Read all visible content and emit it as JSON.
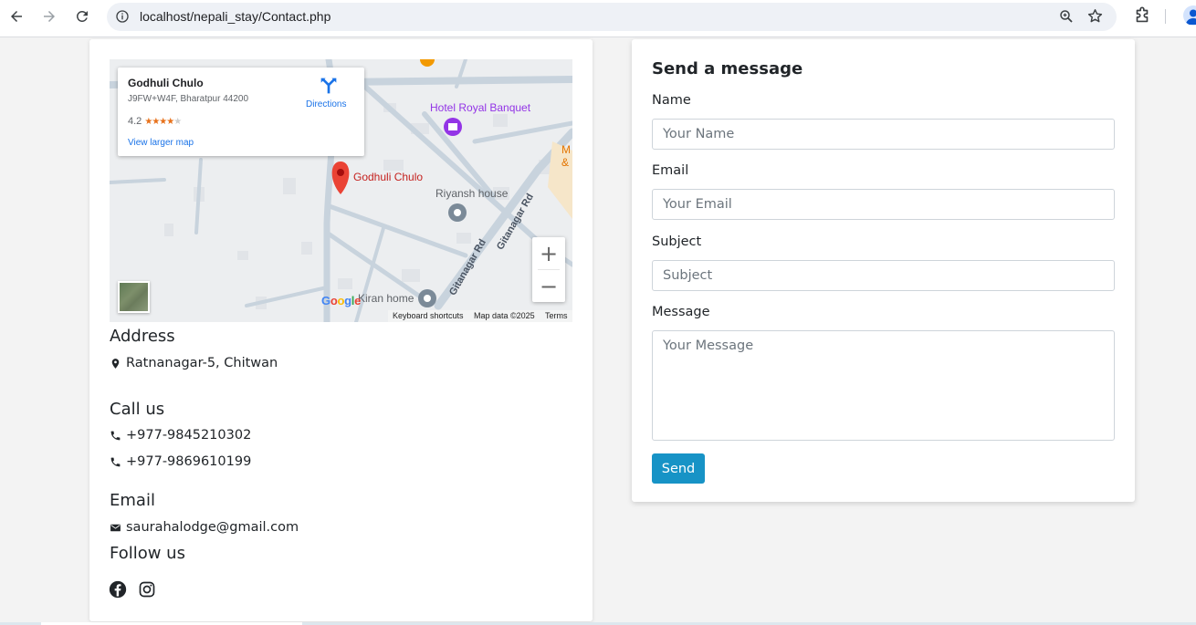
{
  "browser": {
    "url": "localhost/nepali_stay/Contact.php",
    "icons": [
      "back-arrow-icon",
      "forward-arrow-icon",
      "reload-icon",
      "site-info-icon",
      "zoom-icon",
      "bookmark-star-icon",
      "extensions-icon",
      "profile-icon"
    ]
  },
  "map": {
    "place_name": "Godhuli Chulo",
    "place_address": "J9FW+W4F, Bharatpur 44200",
    "rating": "4.2",
    "rating_stars": 4,
    "directions_label": "Directions",
    "view_larger_label": "View larger map",
    "labels": {
      "hotel": "Hotel Royal Banquet",
      "pin": "Godhuli Chulo",
      "riyansh": "Riyansh house",
      "kiran": "Kiran home",
      "road1": "Gitanagar Rd",
      "road2": "Gitanagar Rd",
      "edge_m": "M",
      "edge_amp": "&"
    },
    "zoom_in": "+",
    "zoom_out": "−",
    "google_logo": "Google",
    "attribution": {
      "keyboard": "Keyboard shortcuts",
      "data": "Map data ©2025",
      "terms": "Terms"
    },
    "colors": {
      "pin": "#ea4335",
      "hotel": "#9334e6",
      "link": "#1a73e8",
      "road": "#c5d1dc"
    }
  },
  "contact": {
    "address_heading": "Address",
    "address": "Ratnanagar-5, Chitwan",
    "call_heading": "Call us",
    "phones": [
      "+977-9845210302",
      "+977-9869610199"
    ],
    "email_heading": "Email",
    "email": "saurahalodge@gmail.com",
    "follow_heading": "Follow us",
    "social_icons": [
      "facebook-icon",
      "instagram-icon"
    ]
  },
  "form": {
    "title": "Send a message",
    "name_label": "Name",
    "name_placeholder": "Your Name",
    "email_label": "Email",
    "email_placeholder": "Your Email",
    "subject_label": "Subject",
    "subject_placeholder": "Subject",
    "message_label": "Message",
    "message_placeholder": "Your Message",
    "send_label": "Send",
    "button_color": "#1793c6"
  }
}
